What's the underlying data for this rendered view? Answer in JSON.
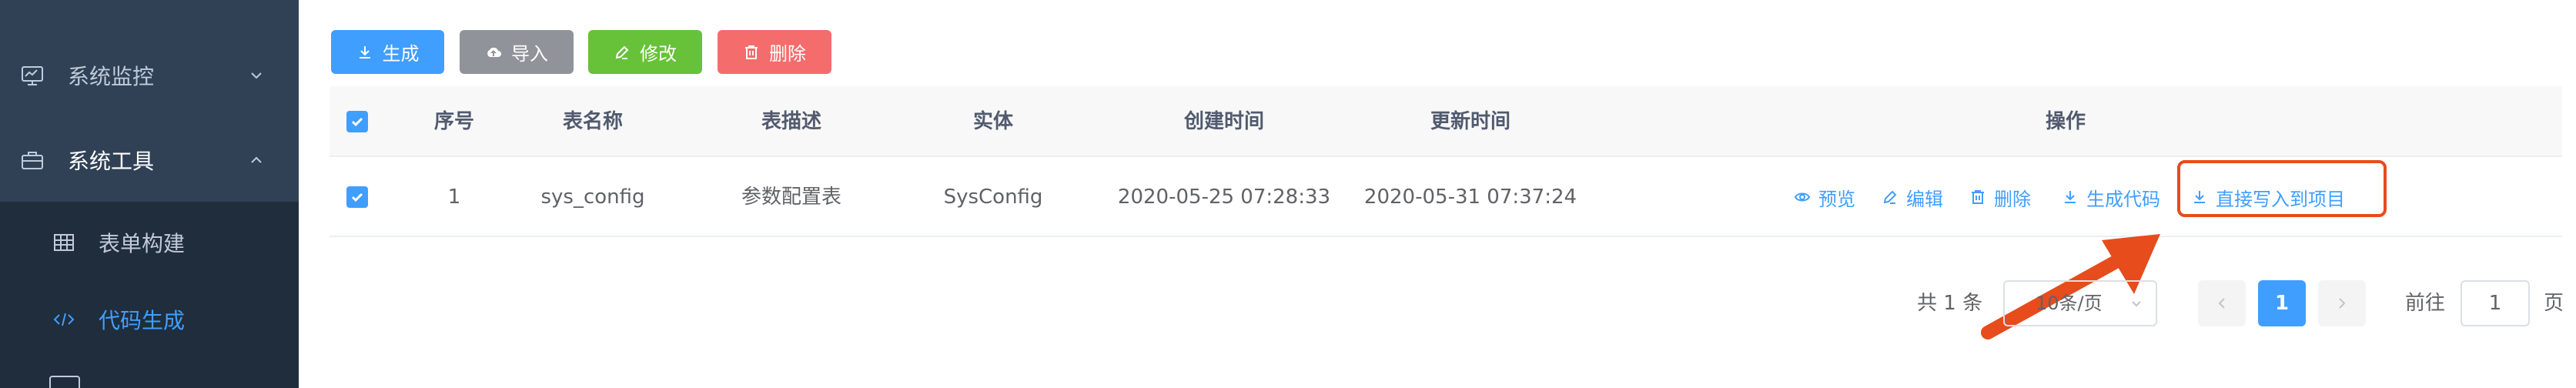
{
  "sidebar": {
    "items": [
      {
        "label": "系统监控",
        "icon": "monitor-icon",
        "expanded": false
      },
      {
        "label": "系统工具",
        "icon": "toolbox-icon",
        "expanded": true
      }
    ],
    "submenu": [
      {
        "label": "表单构建",
        "icon": "table-grid-icon",
        "active": false
      },
      {
        "label": "代码生成",
        "icon": "code-icon",
        "active": true
      }
    ]
  },
  "toolbar": {
    "generate_label": "生成",
    "import_label": "导入",
    "edit_label": "修改",
    "delete_label": "删除"
  },
  "table": {
    "headers": [
      "序号",
      "表名称",
      "表描述",
      "实体",
      "创建时间",
      "更新时间",
      "操作"
    ],
    "rows": [
      {
        "index": "1",
        "table_name": "sys_config",
        "table_desc": "参数配置表",
        "entity": "SysConfig",
        "created": "2020-05-25 07:28:33",
        "updated": "2020-05-31 07:37:24",
        "checked": true
      }
    ],
    "actions": {
      "preview": "预览",
      "edit": "编辑",
      "delete": "删除",
      "gen_code": "生成代码",
      "write_to_project": "直接写入到项目"
    }
  },
  "pagination": {
    "total_text": "共 1 条",
    "page_size": "10条/页",
    "current_page": "1",
    "jump_prefix": "前往",
    "jump_value": "1",
    "jump_suffix": "页"
  },
  "colors": {
    "primary": "#409eff",
    "sidebar_bg": "#304156",
    "annotation": "#e74c1c"
  }
}
